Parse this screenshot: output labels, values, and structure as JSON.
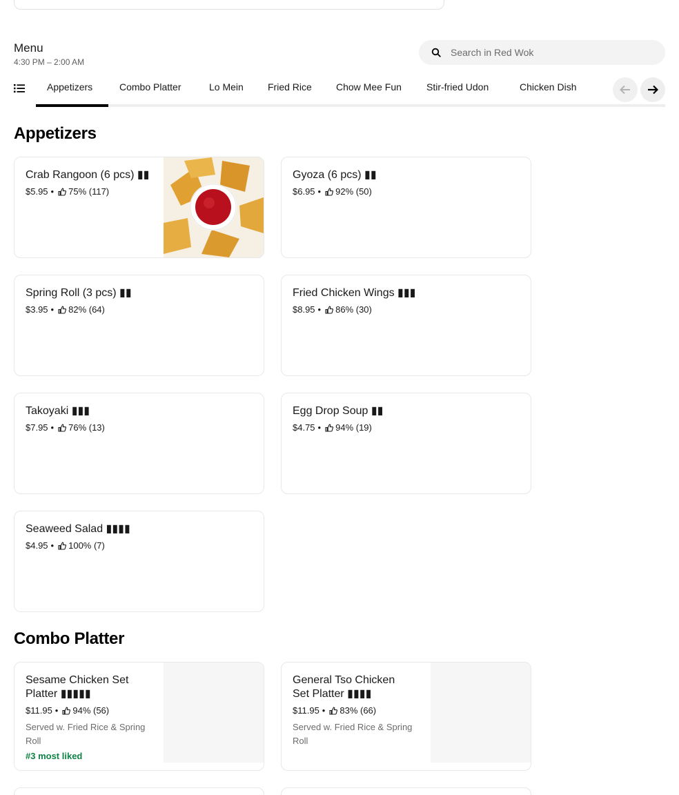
{
  "menu": {
    "title": "Menu",
    "hours": "4:30 PM – 2:00 AM"
  },
  "search": {
    "placeholder": "Search in Red Wok",
    "icon": "search-icon"
  },
  "tabs": [
    {
      "label": "Appetizers",
      "active": true
    },
    {
      "label": "Combo Platter"
    },
    {
      "label": "Lo Mein"
    },
    {
      "label": "Fried Rice"
    },
    {
      "label": "Chow Mee Fun"
    },
    {
      "label": "Stir-fried Udon"
    },
    {
      "label": "Chicken Dish"
    }
  ],
  "sections": {
    "appetizers": {
      "title": "Appetizers",
      "items": [
        {
          "name": "Crab Rangoon (6 pcs) ▮▮",
          "price": "$5.95",
          "rating": "75% (117)",
          "image": true
        },
        {
          "name": "Gyoza (6 pcs) ▮▮",
          "price": "$6.95",
          "rating": "92% (50)"
        },
        {
          "name": "Spring Roll (3 pcs) ▮▮",
          "price": "$3.95",
          "rating": "82% (64)"
        },
        {
          "name": "Fried Chicken Wings ▮▮▮",
          "price": "$8.95",
          "rating": "86% (30)"
        },
        {
          "name": "Takoyaki ▮▮▮",
          "price": "$7.95",
          "rating": "76% (13)"
        },
        {
          "name": "Egg Drop Soup ▮▮",
          "price": "$4.75",
          "rating": "94% (19)"
        },
        {
          "name": "Seaweed Salad ▮▮▮▮",
          "price": "$4.95",
          "rating": "100% (7)"
        }
      ]
    },
    "combo": {
      "title": "Combo Platter",
      "items": [
        {
          "name_line1": "Sesame Chicken Set",
          "name_line2": "Platter ▮▮▮▮▮",
          "price": "$11.95",
          "rating": "94% (56)",
          "desc_line1": "Served w. Fried Rice & Spring",
          "desc_line2": "Roll",
          "badge": "#3 most liked"
        },
        {
          "name_line1": "General Tso Chicken",
          "name_line2": "Set Platter ▮▮▮▮",
          "price": "$11.95",
          "rating": "83% (66)",
          "desc_line1": "Served w. Fried Rice & Spring",
          "desc_line2": "Roll"
        }
      ]
    }
  },
  "separator": "•",
  "colors": {
    "badge": "#0e8345",
    "muted_text": "#6b6b6b",
    "search_bg": "#f3f3f3"
  }
}
